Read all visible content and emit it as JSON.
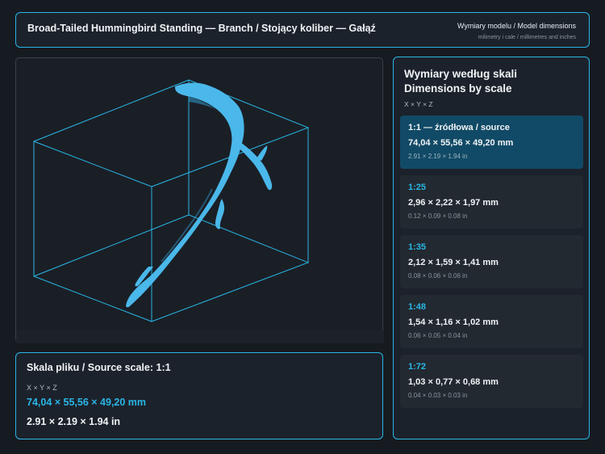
{
  "header": {
    "title": "Broad-Tailed Hummingbird Standing — Branch / Stojący koliber — Gałąź",
    "dimensions_title": "Wymiary modelu / Model dimensions",
    "dimensions_subtitle": "milimetry i cale / millimetres and inches"
  },
  "source_panel": {
    "title": "Skala pliku / Source scale: 1:1",
    "axes": "X × Y × Z",
    "mm": "74,04 × 55,56 × 49,20 mm",
    "inches": "2.91 × 2.19 × 1.94 in"
  },
  "scales_panel": {
    "title_line1": "Wymiary według skali",
    "title_line2": "Dimensions by scale",
    "axes": "X × Y × Z",
    "items": [
      {
        "label": "1:1  —  źródłowa / source",
        "mm": "74,04 × 55,56 × 49,20 mm",
        "inches": "2.91 × 2.19 × 1.94 in",
        "selected": true
      },
      {
        "label": "1:25",
        "mm": "2,96 × 2,22 × 1,97 mm",
        "inches": "0.12 × 0.09 × 0.08 in",
        "selected": false
      },
      {
        "label": "1:35",
        "mm": "2,12 × 1,59 × 1,41 mm",
        "inches": "0.08 × 0.06 × 0.06 in",
        "selected": false
      },
      {
        "label": "1:48",
        "mm": "1,54 × 1,16 × 1,02 mm",
        "inches": "0.06 × 0.05 × 0.04 in",
        "selected": false
      },
      {
        "label": "1:72",
        "mm": "1,03 × 0,77 × 0,68 mm",
        "inches": "0.04 × 0.03 × 0.03 in",
        "selected": false
      }
    ]
  },
  "colors": {
    "accent": "#29b6e6",
    "model": "#4ab8ea",
    "background": "#161b22",
    "panel": "#1c222b",
    "selected_card": "#114a66"
  }
}
